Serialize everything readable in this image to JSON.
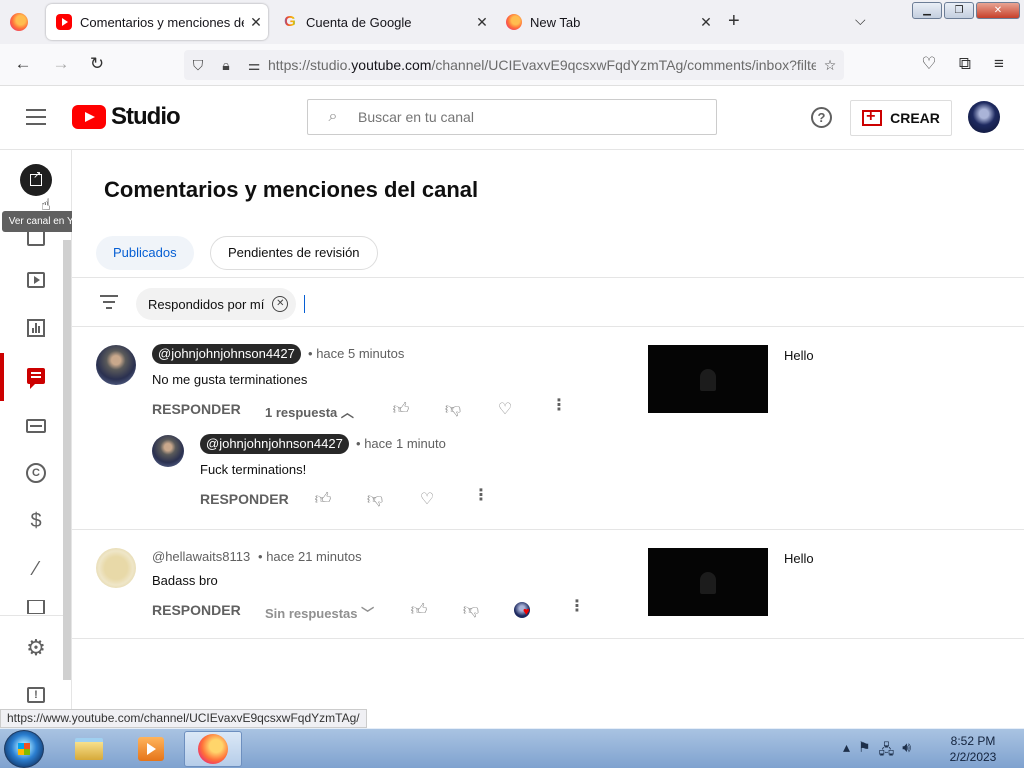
{
  "browser": {
    "tabs": [
      {
        "title": "Comentarios y menciones del c",
        "favicon": "youtube-icon",
        "active": true
      },
      {
        "title": "Cuenta de Google",
        "favicon": "google-icon",
        "active": false
      },
      {
        "title": "New Tab",
        "favicon": "firefox-icon",
        "active": false
      }
    ],
    "url_prefix": "https://studio.",
    "url_host": "youtube.com",
    "url_rest": "/channel/UCIEvaxvE9qcsxwFqdYzmTAg/comments/inbox?filte",
    "status_url": "https://www.youtube.com/channel/UCIEvaxvE9qcsxwFqdYzmTAg/"
  },
  "header": {
    "logo_text": "Studio",
    "search_placeholder": "Buscar en tu canal",
    "create_label": "CREAR",
    "help_glyph": "?"
  },
  "sidebar": {
    "tooltip": "Ver canal en YouTube",
    "items": [
      "dashboard-icon",
      "content-icon",
      "analytics-icon",
      "comments-icon",
      "subtitles-icon",
      "copyright-icon",
      "earn-icon",
      "customization-icon",
      "audio-library-icon",
      "settings-icon",
      "feedback-icon"
    ],
    "copyright_glyph": "C",
    "earn_glyph": "$",
    "feedback_glyph": "!"
  },
  "main": {
    "title": "Comentarios y menciones del canal",
    "tabs": [
      {
        "label": "Publicados",
        "active": true
      },
      {
        "label": "Pendientes de revisión",
        "active": false
      }
    ],
    "filter_chip": "Respondidos por mí",
    "comments": [
      {
        "author": "@johnjohnjohnson4427",
        "time": "hace 5 minutos",
        "text": "No me gusta terminationes",
        "reply_label": "RESPONDER",
        "replies_label": "1 respuesta",
        "video_title": "Hello",
        "reply": {
          "author": "@johnjohnjohnson4427",
          "time": "hace 1 minuto",
          "text": "Fuck terminations!",
          "reply_label": "RESPONDER"
        }
      },
      {
        "author": "@hellawaits8113",
        "time": "hace 21 minutos",
        "text": "Badass bro",
        "reply_label": "RESPONDER",
        "replies_label": "Sin respuestas",
        "video_title": "Hello"
      }
    ],
    "separator_dot": "•"
  },
  "taskbar": {
    "time": "8:52 PM",
    "date": "2/2/2023"
  },
  "colors": {
    "accent_red": "#cc0000",
    "link_blue": "#065fd4",
    "chip_active_bg": "#f0f4f9"
  }
}
